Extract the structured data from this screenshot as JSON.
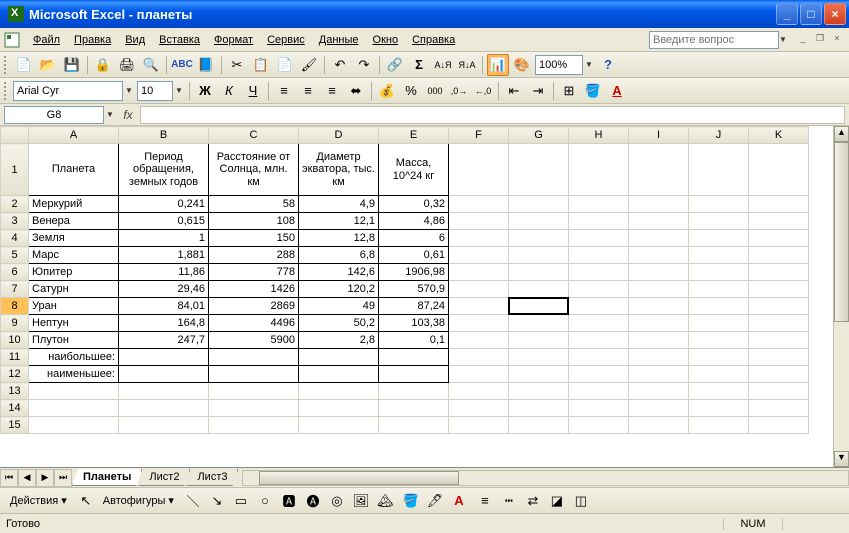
{
  "titlebar": {
    "app": "Microsoft Excel",
    "doc": "планеты"
  },
  "menu": [
    "Файл",
    "Правка",
    "Вид",
    "Вставка",
    "Формат",
    "Сервис",
    "Данные",
    "Окно",
    "Справка"
  ],
  "help_placeholder": "Введите вопрос",
  "font": {
    "name": "Arial Cyr",
    "size": "10"
  },
  "zoom": "100%",
  "name_box": "G8",
  "columns": [
    "A",
    "B",
    "C",
    "D",
    "E",
    "F",
    "G",
    "H",
    "I",
    "J",
    "K"
  ],
  "headers": {
    "A": "Планета",
    "B": "Период обращения, земных годов",
    "C": "Расстояние от Солнца, млн. км",
    "D": "Диаметр экватора, тыс. км",
    "E": "Масса, 10^24 кг"
  },
  "rows": [
    {
      "n": "2",
      "A": "Меркурий",
      "B": "0,241",
      "C": "58",
      "D": "4,9",
      "E": "0,32"
    },
    {
      "n": "3",
      "A": "Венера",
      "B": "0,615",
      "C": "108",
      "D": "12,1",
      "E": "4,86"
    },
    {
      "n": "4",
      "A": "Земля",
      "B": "1",
      "C": "150",
      "D": "12,8",
      "E": "6"
    },
    {
      "n": "5",
      "A": "Марс",
      "B": "1,881",
      "C": "288",
      "D": "6,8",
      "E": "0,61"
    },
    {
      "n": "6",
      "A": "Юпитер",
      "B": "11,86",
      "C": "778",
      "D": "142,6",
      "E": "1906,98"
    },
    {
      "n": "7",
      "A": "Сатурн",
      "B": "29,46",
      "C": "1426",
      "D": "120,2",
      "E": "570,9"
    },
    {
      "n": "8",
      "A": "Уран",
      "B": "84,01",
      "C": "2869",
      "D": "49",
      "E": "87,24"
    },
    {
      "n": "9",
      "A": "Нептун",
      "B": "164,8",
      "C": "4496",
      "D": "50,2",
      "E": "103,38"
    },
    {
      "n": "10",
      "A": "Плутон",
      "B": "247,7",
      "C": "5900",
      "D": "2,8",
      "E": "0,1"
    }
  ],
  "summary": {
    "max_label": "наибольшее:",
    "min_label": "наименьшее:"
  },
  "sheet_tabs": [
    "Планеты",
    "Лист2",
    "Лист3"
  ],
  "draw_labels": {
    "actions": "Действия",
    "autoshapes": "Автофигуры"
  },
  "status": {
    "ready": "Готово",
    "num": "NUM"
  },
  "active_cell": {
    "col": "G",
    "row": 8
  }
}
